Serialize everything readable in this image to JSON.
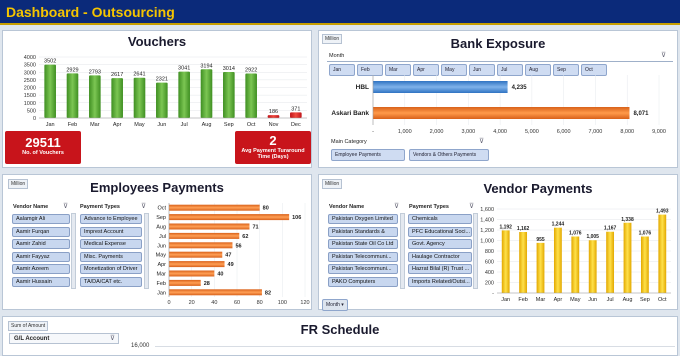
{
  "header": {
    "title": "Dashboard - Outsourcing"
  },
  "vouchers": {
    "title": "Vouchers",
    "total_value": "29511",
    "total_label": "No. of Vouchers",
    "avg_value": "2",
    "avg_label": "Avg Payment Turaround Time (Days)"
  },
  "bank": {
    "title": "Bank Exposure",
    "unit_tag": "Million",
    "month_label": "Month",
    "months": [
      "Jan",
      "Feb",
      "Mar",
      "Apr",
      "May",
      "Jun",
      "Jul",
      "Aug",
      "Sep",
      "Oct"
    ],
    "main_category_label": "Main Category",
    "categories": [
      "Employee Payments",
      "Vendors & Others Payments"
    ]
  },
  "employees": {
    "title": "Employees Payments",
    "unit_tag": "Million",
    "vendor_name_label": "Vendor Name",
    "payment_types_label": "Payment Types",
    "vendor_names": [
      "Aalamgir Ali",
      "Aamir Furqan",
      "Aamir Zahid",
      "Aamir Fayyaz",
      "Aamir Azeem",
      "Aamir Hussain"
    ],
    "payment_types": [
      "Advance to Employee",
      "Imprest Account",
      "Medical Expense",
      "Misc. Payments",
      "Monetization of Driver",
      "TA/DA/CAT etc."
    ]
  },
  "vendor": {
    "title": "Vendor Payments",
    "unit_tag": "Million",
    "vendor_name_label": "Vendor Name",
    "payment_types_label": "Payment Types",
    "vendor_names": [
      "Pakistan Oxygen Limited",
      "Pakistan Standards &",
      "Pakistan State Oil Co Ltd",
      "Pakistan Telecommuni...",
      "Pakistan Telecommuni...",
      "PAKO Computers"
    ],
    "payment_types": [
      "Chemicals",
      "PFC Educational Soci...",
      "Govt. Agency",
      "Haulage Contractor",
      "Hazrat Bilal (R) Trust ...",
      "Imports Related/Outsi..."
    ],
    "month_button": "Month"
  },
  "fr": {
    "title": "FR Schedule",
    "sum_tag": "Sum of Amount",
    "gl_label": "G/L Account",
    "first_tick": "16,000"
  },
  "chart_data": [
    {
      "type": "bar",
      "title": "Vouchers",
      "categories": [
        "Jan",
        "Feb",
        "Mar",
        "Apr",
        "May",
        "Jun",
        "Jul",
        "Aug",
        "Sep",
        "Oct",
        "Nov",
        "Dec"
      ],
      "series": [
        {
          "values": [
            3502,
            2929,
            2793,
            2617,
            2641,
            2321,
            3041,
            3194,
            3014,
            2922,
            186,
            371
          ]
        }
      ],
      "y_ticks": [
        "0",
        "500",
        "1000",
        "1500",
        "2000",
        "2500",
        "3000",
        "3500",
        "4000"
      ],
      "ylim": [
        0,
        4000
      ],
      "colors": {
        "main": "#5aa832",
        "last_two": "#e0261d"
      }
    },
    {
      "type": "bar",
      "orientation": "horizontal",
      "title": "Bank Exposure",
      "categories": [
        "HBL",
        "Askari Bank"
      ],
      "values": [
        4235,
        8071
      ],
      "value_labels": [
        "4,235",
        "8,071"
      ],
      "x_ticks": [
        "-",
        "1,000",
        "2,000",
        "3,000",
        "4,000",
        "5,000",
        "6,000",
        "7,000",
        "8,000",
        "9,000"
      ],
      "xlim": [
        0,
        9000
      ],
      "colors": [
        "#4a8fd8",
        "#f07a22"
      ]
    },
    {
      "type": "bar",
      "orientation": "horizontal",
      "title": "Employees Payments",
      "categories": [
        "Oct",
        "Sep",
        "Aug",
        "Jul",
        "Jun",
        "May",
        "Apr",
        "Mar",
        "Feb",
        "Jan"
      ],
      "values": [
        80,
        106,
        71,
        62,
        56,
        47,
        49,
        40,
        28,
        82
      ],
      "x_ticks": [
        "0",
        "20",
        "40",
        "60",
        "80",
        "100",
        "120"
      ],
      "xlim": [
        0,
        120
      ],
      "color": "#f07a22"
    },
    {
      "type": "bar",
      "title": "Vendor Payments",
      "categories": [
        "Jan",
        "Feb",
        "Mar",
        "Apr",
        "May",
        "Jun",
        "Jul",
        "Aug",
        "Sep",
        "Oct"
      ],
      "values": [
        1192,
        1162,
        955,
        1244,
        1076,
        1005,
        1167,
        1338,
        1076,
        1493
      ],
      "value_labels": [
        "1,192",
        "1,162",
        "955",
        "1,244",
        "1,076",
        "1,005",
        "1,167",
        "1,338",
        "1,076",
        "1,493"
      ],
      "y_ticks": [
        "-",
        "200",
        "400",
        "600",
        "800",
        "1,000",
        "1,200",
        "1,400",
        "1,600"
      ],
      "ylim": [
        0,
        1600
      ],
      "color": "#f5c000"
    }
  ]
}
